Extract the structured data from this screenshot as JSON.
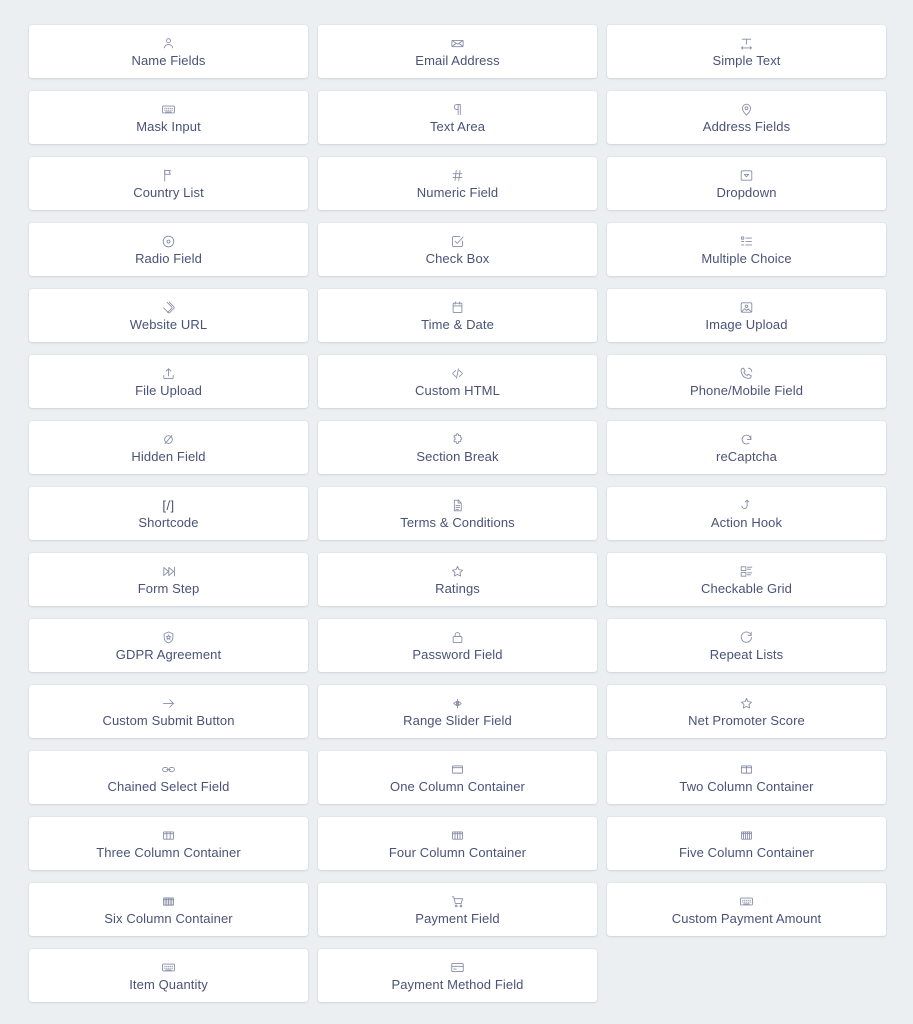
{
  "palette": {
    "background": "#eceff1",
    "card_background": "#ffffff",
    "label_color": "#4a5277",
    "icon_color": "#858ca7"
  },
  "field_palette": {
    "columns": 3,
    "fields": [
      {
        "label": "Name Fields",
        "icon": "user-icon"
      },
      {
        "label": "Email Address",
        "icon": "envelope-icon"
      },
      {
        "label": "Simple Text",
        "icon": "text-width-icon"
      },
      {
        "label": "Mask Input",
        "icon": "keyboard-icon"
      },
      {
        "label": "Text Area",
        "icon": "paragraph-icon"
      },
      {
        "label": "Address Fields",
        "icon": "map-pin-icon"
      },
      {
        "label": "Country List",
        "icon": "flag-icon"
      },
      {
        "label": "Numeric Field",
        "icon": "hash-icon"
      },
      {
        "label": "Dropdown",
        "icon": "dropdown-caret-icon"
      },
      {
        "label": "Radio Field",
        "icon": "radio-circle-icon"
      },
      {
        "label": "Check Box",
        "icon": "checkbox-check-icon"
      },
      {
        "label": "Multiple Choice",
        "icon": "list-ul-icon"
      },
      {
        "label": "Website URL",
        "icon": "link-diamond-icon"
      },
      {
        "label": "Time & Date",
        "icon": "calendar-icon"
      },
      {
        "label": "Image Upload",
        "icon": "image-icon"
      },
      {
        "label": "File Upload",
        "icon": "upload-icon"
      },
      {
        "label": "Custom HTML",
        "icon": "code-tag-icon"
      },
      {
        "label": "Phone/Mobile Field",
        "icon": "phone-icon"
      },
      {
        "label": "Hidden Field",
        "icon": "eye-slash-icon"
      },
      {
        "label": "Section Break",
        "icon": "puzzle-icon"
      },
      {
        "label": "reCaptcha",
        "icon": "recaptcha-arc-icon"
      },
      {
        "label": "Shortcode",
        "icon": "shortcode-bracket-icon"
      },
      {
        "label": "Terms & Conditions",
        "icon": "document-icon"
      },
      {
        "label": "Action Hook",
        "icon": "hook-icon"
      },
      {
        "label": "Form Step",
        "icon": "forward-step-icon"
      },
      {
        "label": "Ratings",
        "icon": "star-icon"
      },
      {
        "label": "Checkable Grid",
        "icon": "grid-check-icon"
      },
      {
        "label": "GDPR Agreement",
        "icon": "shield-star-icon"
      },
      {
        "label": "Password Field",
        "icon": "lock-icon"
      },
      {
        "label": "Repeat Lists",
        "icon": "refresh-arc-icon"
      },
      {
        "label": "Custom Submit Button",
        "icon": "arrow-right-icon"
      },
      {
        "label": "Range Slider Field",
        "icon": "range-slider-icon"
      },
      {
        "label": "Net Promoter Score",
        "icon": "star-icon"
      },
      {
        "label": "Chained Select Field",
        "icon": "chain-link-icon"
      },
      {
        "label": "One Column Container",
        "icon": "column-1-icon"
      },
      {
        "label": "Two Column Container",
        "icon": "column-2-icon"
      },
      {
        "label": "Three Column Container",
        "icon": "column-3-icon"
      },
      {
        "label": "Four Column Container",
        "icon": "column-4-icon"
      },
      {
        "label": "Five Column Container",
        "icon": "column-5-icon"
      },
      {
        "label": "Six Column Container",
        "icon": "column-6-icon"
      },
      {
        "label": "Payment Field",
        "icon": "shopping-cart-icon"
      },
      {
        "label": "Custom Payment Amount",
        "icon": "keyboard-icon"
      },
      {
        "label": "Item Quantity",
        "icon": "keyboard-icon"
      },
      {
        "label": "Payment Method Field",
        "icon": "credit-card-icon"
      }
    ]
  }
}
